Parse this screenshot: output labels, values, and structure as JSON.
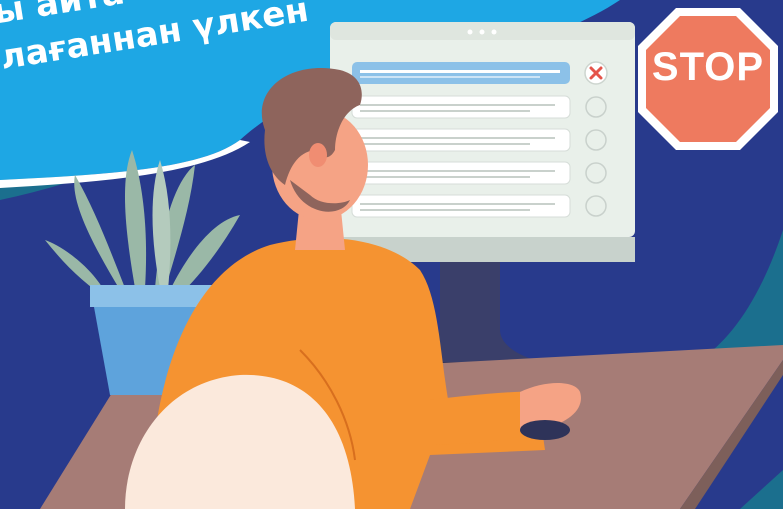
{
  "headline": {
    "line1": "ы айта о",
    "line2": "лағаннан үлкен"
  },
  "stop_sign": {
    "label": "STOP",
    "color": "#ee7a5f"
  },
  "screen_list": {
    "rows": [
      {
        "selected": true,
        "mark": "close-icon"
      },
      {
        "selected": false,
        "mark": "radio-empty"
      },
      {
        "selected": false,
        "mark": "radio-empty"
      },
      {
        "selected": false,
        "mark": "radio-empty"
      },
      {
        "selected": false,
        "mark": "radio-empty"
      }
    ]
  },
  "colors": {
    "background": "#283a8c",
    "banner": "#1ea7e4",
    "wave": "#1b6f8e",
    "desk": "#a67c76",
    "shirt": "#f59331",
    "hair": "#8e645c",
    "skin": "#f5a385",
    "plant": "#9ab8a7",
    "pot": "#5ea3dc",
    "screen": "#e9f0ea"
  }
}
